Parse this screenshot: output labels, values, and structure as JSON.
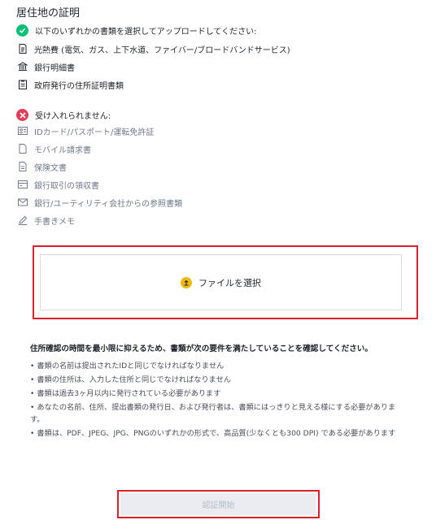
{
  "page": {
    "title": "居住地の証明"
  },
  "accepted": {
    "heading": "以下のいずれかの書類を選択してアップロードしてください:",
    "icon": "check-circle-icon",
    "color": "#02c076",
    "items": [
      {
        "label": "光熱費 (電気、ガス、上下水道、ファイバー/ブロードバンドサービス)",
        "icon": "bill-icon"
      },
      {
        "label": "銀行明細書",
        "icon": "bank-icon"
      },
      {
        "label": "政府発行の住所証明書類",
        "icon": "government-doc-icon"
      }
    ]
  },
  "rejected": {
    "heading": "受け入れられません:",
    "icon": "cross-circle-icon",
    "color": "#e33e59",
    "items": [
      {
        "label": "IDカード/パスポート/運転免許証",
        "icon": "id-card-icon"
      },
      {
        "label": "モバイル請求書",
        "icon": "document-icon"
      },
      {
        "label": "保険文書",
        "icon": "insurance-doc-icon"
      },
      {
        "label": "銀行取引の領収書",
        "icon": "receipt-icon"
      },
      {
        "label": "銀行/ユーティリティ会社からの参照書類",
        "icon": "mail-icon"
      },
      {
        "label": "手書きメモ",
        "icon": "pen-icon"
      }
    ]
  },
  "upload": {
    "label": "ファイルを選択",
    "icon": "upload-icon",
    "accent": "#f0b90b"
  },
  "requirements": {
    "title": "住所確認の時間を最小限に抑えるため、書類が次の要件を満たしていることを確認してください。",
    "items": [
      "• 書類の名前は提出されたIDと同じでなければなりません",
      "• 書類の住所は、入力した住所と同じでなければなりません",
      "• 書類は過去3ヶ月以内に発行されている必要があります",
      "• あなたの名前、住所、提出書類の発行日、および発行者は、書類にはっきりと見える様にする必要があります。",
      "• 書類は、PDF、JPEG、JPG、PNGのいずれかの形式で、高品質(少なくとも300 DPI) である必要があります"
    ]
  },
  "submit": {
    "label": "認証開始",
    "state": "disabled"
  },
  "highlight_color": "#d9202a"
}
